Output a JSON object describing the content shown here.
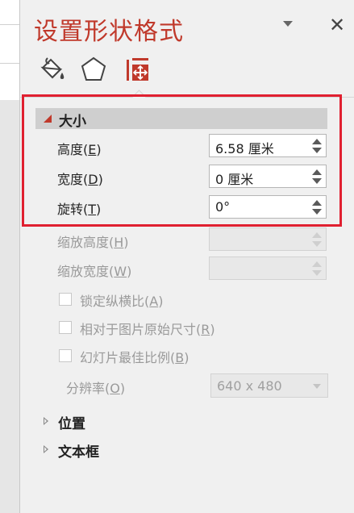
{
  "panel": {
    "title": "设置形状格式",
    "close_glyph": "✕"
  },
  "tabs": [
    {
      "name": "填充与线条",
      "icon": "paint-bucket-icon"
    },
    {
      "name": "效果",
      "icon": "pentagon-icon"
    },
    {
      "name": "大小与属性",
      "icon": "size-properties-icon",
      "active": true
    }
  ],
  "size_section": {
    "label": "大小",
    "height_label": "高度(",
    "height_key": "E",
    "height_value": "6.58 厘米",
    "width_label": "宽度(",
    "width_key": "D",
    "width_value": "0 厘米",
    "rotation_label": "旋转(",
    "rotation_key": "T",
    "rotation_value": "0°",
    "scale_height_label": "缩放高度(",
    "scale_height_key": "H",
    "scale_width_label": "缩放宽度(",
    "scale_width_key": "W",
    "lock_ratio_label": "锁定纵横比(",
    "lock_ratio_key": "A",
    "relative_label": "相对于图片原始尺寸(",
    "relative_key": "R",
    "best_scale_label": "幻灯片最佳比例(",
    "best_scale_key": "B",
    "resolution_label": "分辨率(",
    "resolution_key": "O",
    "resolution_value": "640 x 480",
    "close_paren": ")"
  },
  "collapsed_sections": {
    "position": "位置",
    "textbox": "文本框"
  },
  "colors": {
    "accent": "#c0392b",
    "highlight_box": "#e02030"
  }
}
